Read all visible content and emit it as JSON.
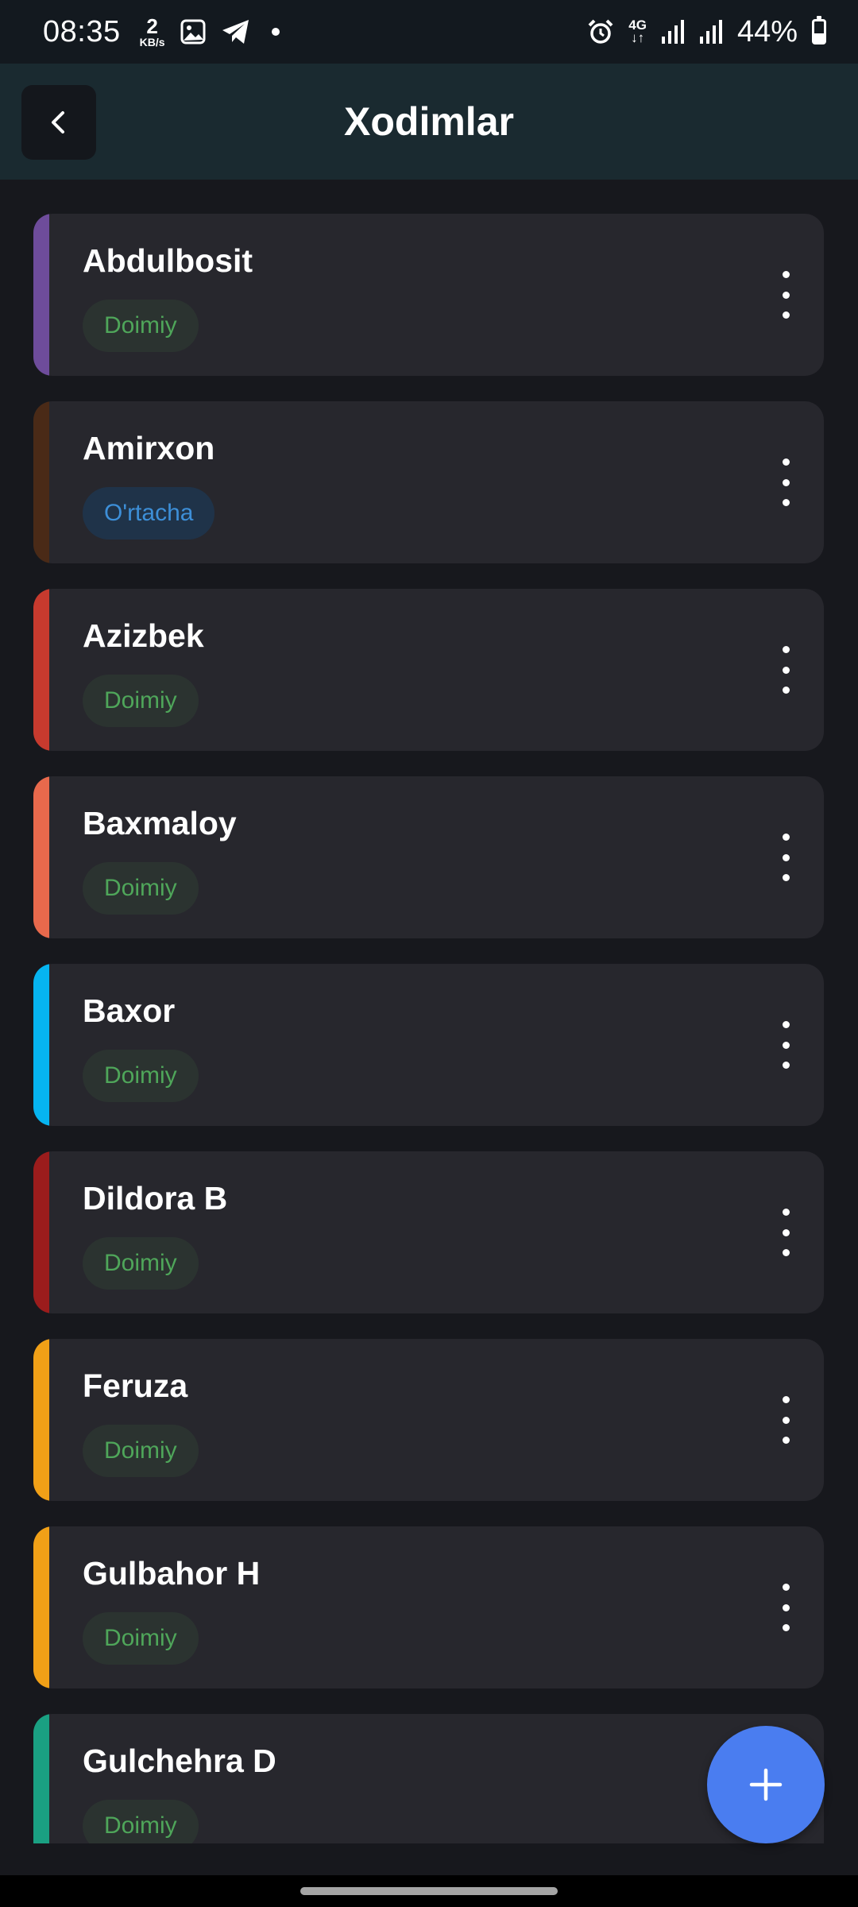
{
  "status_bar": {
    "time": "08:35",
    "speed_value": "2",
    "speed_unit": "KB/s",
    "net_gen": "4G",
    "net_arrows": "↓↑",
    "battery": "44%",
    "battery_level": 0.44,
    "icons": [
      "image-icon",
      "telegram-icon",
      "alarm-icon",
      "signal-icon",
      "signal-icon",
      "battery-icon"
    ]
  },
  "header": {
    "title": "Xodimlar",
    "back_icon": "chevron-left-icon"
  },
  "employees": [
    {
      "name": "Abdulbosit",
      "status": "Doimiy",
      "accent": "#6e4c9b"
    },
    {
      "name": "Amirxon",
      "status": "O'rtacha",
      "accent": "#4a2a17"
    },
    {
      "name": "Azizbek",
      "status": "Doimiy",
      "accent": "#c73a2e"
    },
    {
      "name": "Baxmaloy",
      "status": "Doimiy",
      "accent": "#e8694c"
    },
    {
      "name": "Baxor",
      "status": "Doimiy",
      "accent": "#06b4f0"
    },
    {
      "name": "Dildora B",
      "status": "Doimiy",
      "accent": "#9b1c1c"
    },
    {
      "name": "Feruza",
      "status": "Doimiy",
      "accent": "#f1a017"
    },
    {
      "name": "Gulbahor H",
      "status": "Doimiy",
      "accent": "#f1a017"
    },
    {
      "name": "Gulchehra D",
      "status": "Doimiy",
      "accent": "#1aa082"
    }
  ],
  "colors": {
    "background": "#17181d",
    "card": "#27272d",
    "header": "#1a2a30",
    "status_doimiy_text": "#4fa65a",
    "status_ortacha_text": "#3d8fd8",
    "fab": "#4a7df0"
  },
  "fab": {
    "icon": "plus-icon"
  }
}
